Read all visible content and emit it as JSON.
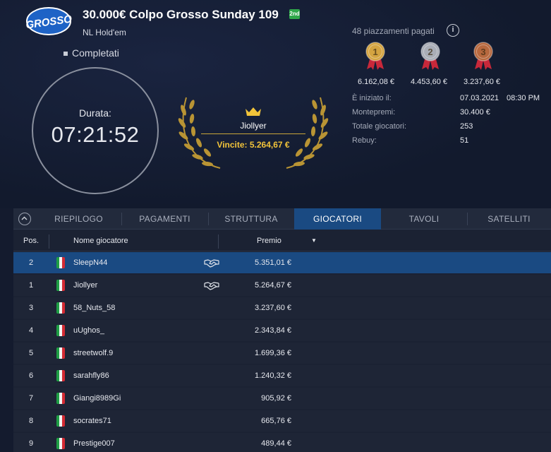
{
  "header": {
    "logo_text": "GROSSO",
    "title": "30.000€ Colpo Grosso Sunday 109",
    "badge": "2nd",
    "subtitle": "NL Hold'em",
    "status": "Completati"
  },
  "duration": {
    "label": "Durata:",
    "value": "07:21:52"
  },
  "winner": {
    "name": "Jiollyer",
    "prize": "Vincite: 5.264,67 €"
  },
  "payouts": {
    "paid_label": "48 piazzamenti pagati",
    "medals": [
      {
        "rank": "1",
        "value": "6.162,08 €",
        "color": "#d4a441"
      },
      {
        "rank": "2",
        "value": "4.453,60 €",
        "color": "#a9adb6"
      },
      {
        "rank": "3",
        "value": "3.237,60 €",
        "color": "#b7683e"
      }
    ]
  },
  "stats": [
    {
      "label": "È iniziato il:",
      "value": "07.03.2021",
      "value2": "08:30 PM"
    },
    {
      "label": "Montepremi:",
      "value": "30.400 €"
    },
    {
      "label": "Totale giocatori:",
      "value": "253"
    },
    {
      "label": "Rebuy:",
      "value": "51"
    }
  ],
  "tabs": [
    "RIEPILOGO",
    "PAGAMENTI",
    "STRUTTURA",
    "GIOCATORI",
    "TAVOLI",
    "SATELLITI"
  ],
  "active_tab": "GIOCATORI",
  "table": {
    "headers": {
      "pos": "Pos.",
      "name": "Nome giocatore",
      "prize": "Premio"
    },
    "rows": [
      {
        "pos": "2",
        "name": "SleepN44",
        "prize": "5.351,01 €",
        "deal": true,
        "selected": true
      },
      {
        "pos": "1",
        "name": "Jiollyer",
        "prize": "5.264,67 €",
        "deal": true,
        "selected": false
      },
      {
        "pos": "3",
        "name": "58_Nuts_58",
        "prize": "3.237,60 €",
        "deal": false,
        "selected": false
      },
      {
        "pos": "4",
        "name": "uUghos_",
        "prize": "2.343,84 €",
        "deal": false,
        "selected": false
      },
      {
        "pos": "5",
        "name": "streetwolf.9",
        "prize": "1.699,36 €",
        "deal": false,
        "selected": false
      },
      {
        "pos": "6",
        "name": "sarahfly86",
        "prize": "1.240,32 €",
        "deal": false,
        "selected": false
      },
      {
        "pos": "7",
        "name": "Giangi8989Gi",
        "prize": "905,92 €",
        "deal": false,
        "selected": false
      },
      {
        "pos": "8",
        "name": "socrates71",
        "prize": "665,76 €",
        "deal": false,
        "selected": false
      },
      {
        "pos": "9",
        "name": "Prestige007",
        "prize": "489,44 €",
        "deal": false,
        "selected": false
      }
    ]
  },
  "colors": {
    "accent": "#1a4a82",
    "gold": "#f2c43a",
    "background": "#141b2e"
  }
}
